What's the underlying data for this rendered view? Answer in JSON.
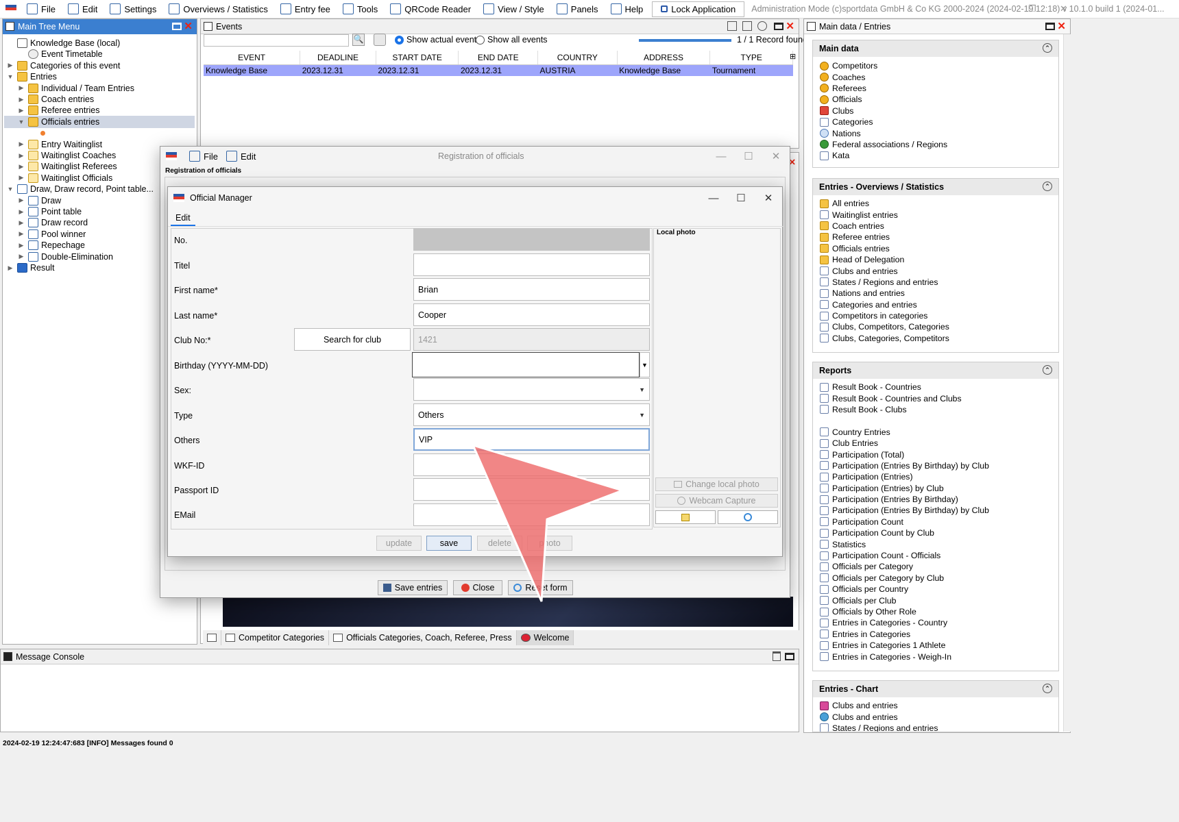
{
  "menubar": {
    "items": [
      {
        "label": "File",
        "icon": "file-icon"
      },
      {
        "label": "Edit",
        "icon": "edit-icon"
      },
      {
        "label": "Settings",
        "icon": "gear-icon"
      },
      {
        "label": "Overviews / Statistics",
        "icon": "overview-icon"
      },
      {
        "label": "Entry fee",
        "icon": "money-icon"
      },
      {
        "label": "Tools",
        "icon": "wrench-icon"
      },
      {
        "label": "QRCode Reader",
        "icon": "qrcode-icon"
      },
      {
        "label": "View / Style",
        "icon": "view-icon"
      },
      {
        "label": "Panels",
        "icon": "panels-icon"
      },
      {
        "label": "Help",
        "icon": "help-icon"
      }
    ],
    "lock_label": "Lock Application",
    "admin_info": "Administration Mode (c)sportdata GmbH & Co KG 2000-2024 (2024-02-19 12:18)  v 10.1.0 build 1 (2024-01..."
  },
  "tree": {
    "title": "Main Tree Menu",
    "items": [
      {
        "label": "Knowledge Base (local)",
        "level": 0,
        "twisty": "",
        "icon": "kb"
      },
      {
        "label": "Event Timetable",
        "level": 1,
        "twisty": "",
        "icon": "clock"
      },
      {
        "label": "Categories of this event",
        "level": 0,
        "twisty": "▶",
        "icon": "folder"
      },
      {
        "label": "Entries",
        "level": 0,
        "twisty": "▼",
        "icon": "folder"
      },
      {
        "label": "Individual / Team Entries",
        "level": 1,
        "twisty": "▶",
        "icon": "folder"
      },
      {
        "label": "Coach entries",
        "level": 1,
        "twisty": "▶",
        "icon": "folder"
      },
      {
        "label": "Referee entries",
        "level": 1,
        "twisty": "▶",
        "icon": "folder"
      },
      {
        "label": "Officials entries",
        "level": 1,
        "twisty": "▼",
        "icon": "folder",
        "selected": true
      },
      {
        "label": "",
        "level": 2,
        "twisty": "",
        "icon": "dot"
      },
      {
        "label": "Entry Waitinglist",
        "level": 1,
        "twisty": "▶",
        "icon": "wl"
      },
      {
        "label": "Waitinglist Coaches",
        "level": 1,
        "twisty": "▶",
        "icon": "wl"
      },
      {
        "label": "Waitinglist Referees",
        "level": 1,
        "twisty": "▶",
        "icon": "wl"
      },
      {
        "label": "Waitinglist Officials",
        "level": 1,
        "twisty": "▶",
        "icon": "wl"
      },
      {
        "label": "Draw, Draw record, Point table...",
        "level": 0,
        "twisty": "▼",
        "icon": "doc"
      },
      {
        "label": "Draw",
        "level": 1,
        "twisty": "▶",
        "icon": "doc"
      },
      {
        "label": "Point table",
        "level": 1,
        "twisty": "▶",
        "icon": "doc"
      },
      {
        "label": "Draw record",
        "level": 1,
        "twisty": "▶",
        "icon": "doc"
      },
      {
        "label": "Pool winner",
        "level": 1,
        "twisty": "▶",
        "icon": "doc"
      },
      {
        "label": "Repechage",
        "level": 1,
        "twisty": "▶",
        "icon": "doc"
      },
      {
        "label": "Double-Elimination",
        "level": 1,
        "twisty": "▶",
        "icon": "doc"
      },
      {
        "label": "Result",
        "level": 0,
        "twisty": "▶",
        "icon": "res"
      }
    ]
  },
  "events": {
    "title": "Events",
    "search_placeholder": "",
    "radio_actual": "Show actual events",
    "radio_all": "Show all events",
    "record_count": "1 / 1 Record found",
    "columns": [
      "EVENT",
      "DEADLINE",
      "START DATE",
      "END DATE",
      "COUNTRY",
      "ADDRESS",
      "TYPE"
    ],
    "rows": [
      [
        "Knowledge Base",
        "2023.12.31",
        "2023.12.31",
        "2023.12.31",
        "AUSTRIA",
        "Knowledge Base",
        "Tournament"
      ]
    ]
  },
  "registration": {
    "menu_file": "File",
    "menu_edit": "Edit",
    "window_title": "Registration of officials",
    "group_label": "Registration of officials",
    "save_entries": "Save entries",
    "close": "Close",
    "reset_form": "Reset form"
  },
  "manager": {
    "title": "Official Manager",
    "tab": "Edit",
    "local_photo": "Local photo",
    "fields": {
      "no_label": "No.",
      "no_value": "",
      "titel_label": "Titel",
      "titel_value": "",
      "first_label": "First name*",
      "first_value": "Brian",
      "last_label": "Last name*",
      "last_value": "Cooper",
      "club_label": "Club No:*",
      "club_value": "1421",
      "search_club": "Search for club",
      "birthday_label": "Birthday (YYYY-MM-DD)",
      "birthday_value": "",
      "sex_label": "Sex:",
      "sex_value": "",
      "type_label": "Type",
      "type_value": "Others",
      "others_label": "Others",
      "others_value": "VIP",
      "wkf_label": "WKF-ID",
      "wkf_value": "",
      "passport_label": "Passport ID",
      "passport_value": "",
      "email_label": "EMail",
      "email_value": ""
    },
    "change_photo": "Change local photo",
    "webcam": "Webcam Capture",
    "btn_update": "update",
    "btn_save": "save",
    "btn_delete": "delete",
    "btn_photo": "photo"
  },
  "right": {
    "title": "Main data / Entries",
    "main_data": {
      "head": "Main data",
      "items": [
        {
          "label": "Competitors",
          "icon": "person"
        },
        {
          "label": "Coaches",
          "icon": "person"
        },
        {
          "label": "Referees",
          "icon": "person"
        },
        {
          "label": "Officials",
          "icon": "person"
        },
        {
          "label": "Clubs",
          "icon": "club"
        },
        {
          "label": "Categories",
          "icon": "doc"
        },
        {
          "label": "Nations",
          "icon": "nation"
        },
        {
          "label": "Federal associations / Regions",
          "icon": "fed"
        },
        {
          "label": "Kata",
          "icon": "doc"
        }
      ]
    },
    "overviews": {
      "head": "Entries - Overviews / Statistics",
      "items": [
        {
          "label": "All entries",
          "icon": "folder"
        },
        {
          "label": "Waitinglist entries",
          "icon": "doc"
        },
        {
          "label": "Coach entries",
          "icon": "folder"
        },
        {
          "label": "Referee entries",
          "icon": "folder"
        },
        {
          "label": "Officials entries",
          "icon": "folder"
        },
        {
          "label": "Head of Delegation",
          "icon": "folder"
        },
        {
          "label": "Clubs and entries",
          "icon": "doc"
        },
        {
          "label": "States / Regions and entries",
          "icon": "doc"
        },
        {
          "label": "Nations and entries",
          "icon": "doc"
        },
        {
          "label": "Categories and entries",
          "icon": "doc"
        },
        {
          "label": "Competitors in categories",
          "icon": "doc"
        },
        {
          "label": "Clubs, Competitors, Categories",
          "icon": "doc"
        },
        {
          "label": "Clubs, Categories, Competitors",
          "icon": "doc"
        }
      ]
    },
    "reports": {
      "head": "Reports",
      "items": [
        {
          "label": "Result Book - Countries"
        },
        {
          "label": "Result Book - Countries and Clubs"
        },
        {
          "label": "Result Book - Clubs"
        },
        {
          "label": ""
        },
        {
          "label": "Country Entries"
        },
        {
          "label": "Club Entries"
        },
        {
          "label": "Participation (Total)"
        },
        {
          "label": "Participation (Entries By Birthday) by Club"
        },
        {
          "label": "Participation (Entries)"
        },
        {
          "label": "Participation (Entries) by Club"
        },
        {
          "label": "Participation (Entries By Birthday)"
        },
        {
          "label": "Participation (Entries By Birthday) by Club"
        },
        {
          "label": "Participation Count"
        },
        {
          "label": "Participation Count by Club"
        },
        {
          "label": "Statistics"
        },
        {
          "label": "Participation Count - Officials"
        },
        {
          "label": "Officials per Category"
        },
        {
          "label": "Officials per Category by Club"
        },
        {
          "label": "Officials per Country"
        },
        {
          "label": "Officials per Club"
        },
        {
          "label": "Officials by Other Role"
        },
        {
          "label": "Entries in Categories - Country"
        },
        {
          "label": "Entries in Categories"
        },
        {
          "label": "Entries in Categories 1 Athlete"
        },
        {
          "label": "Entries in Categories - Weigh-In"
        }
      ]
    },
    "chart": {
      "head": "Entries - Chart",
      "items": [
        {
          "label": "Clubs and entries",
          "icon": "chart"
        },
        {
          "label": "Clubs and entries",
          "icon": "pie"
        },
        {
          "label": "States / Regions and entries",
          "icon": "doc"
        }
      ]
    }
  },
  "bottom_tabs": [
    "Competitor Categories",
    "Officials Categories, Coach, Referee, Press",
    "Welcome"
  ],
  "console": {
    "title": "Message Console"
  },
  "status": "2024-02-19 12:24:47:683 [INFO] Messages found 0",
  "colors": {
    "title_blue": "#3b7fd0",
    "row_selected": "#9da5fb",
    "arrow_red": "#ee6b6b"
  }
}
